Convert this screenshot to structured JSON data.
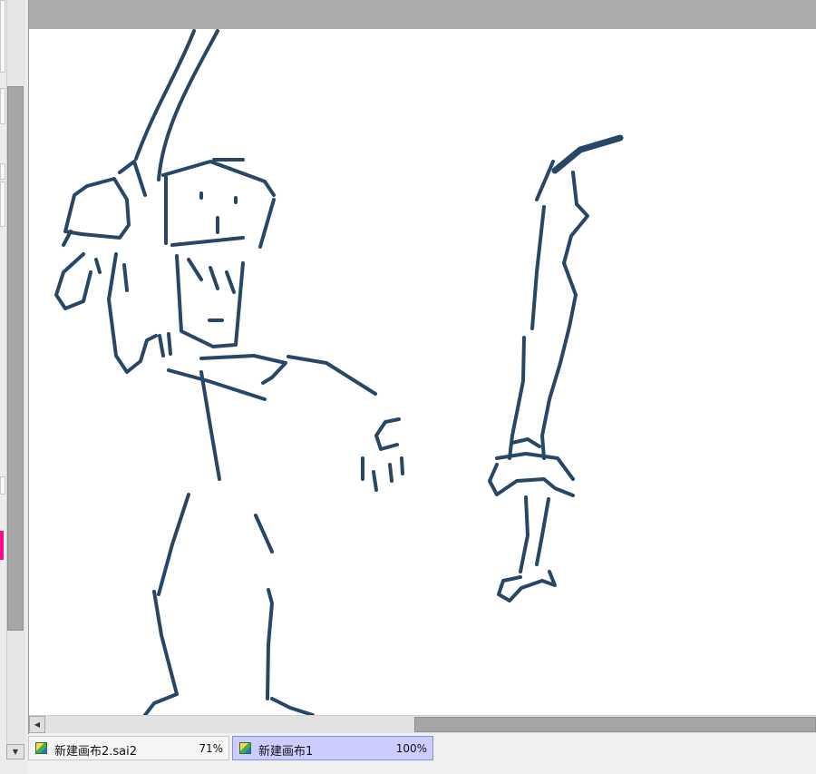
{
  "colors": {
    "stroke": "#264766",
    "canvas_bg": "#ffffff",
    "workspace_gray": "#ababab",
    "active_tab_bg": "#ccccff",
    "accent_swatch": "#ff0a8c"
  },
  "icons": {
    "tab_icon": "sai-document-icon",
    "scroll_left": "arrow-left-icon",
    "scroll_down": "arrow-down-icon"
  },
  "tabs": [
    {
      "title": "新建画布2.sai2",
      "zoom": "71%",
      "active": false
    },
    {
      "title": "新建画布1",
      "zoom": "100%",
      "active": true
    }
  ]
}
